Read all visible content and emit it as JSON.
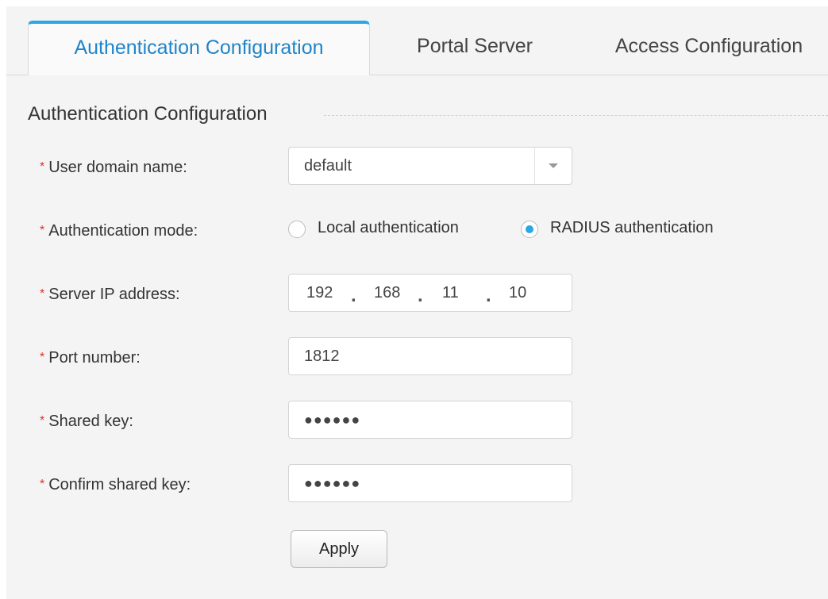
{
  "tabs": [
    {
      "label": "Authentication Configuration",
      "active": true
    },
    {
      "label": "Portal Server",
      "active": false
    },
    {
      "label": "Access Configuration",
      "active": false
    }
  ],
  "section": {
    "title": "Authentication Configuration"
  },
  "required_marker": "*",
  "form": {
    "user_domain": {
      "label": "User domain name:",
      "value": "default"
    },
    "auth_mode": {
      "label": "Authentication mode:",
      "options": [
        {
          "label": "Local authentication",
          "selected": false
        },
        {
          "label": "RADIUS authentication",
          "selected": true
        }
      ]
    },
    "server_ip": {
      "label": "Server IP address:",
      "octets": [
        "192",
        "168",
        "11",
        "10"
      ],
      "separator": "."
    },
    "port": {
      "label": "Port number:",
      "value": "1812"
    },
    "shared_key": {
      "label": "Shared key:",
      "masked": "●●●●●●"
    },
    "confirm_key": {
      "label": "Confirm shared key:",
      "masked": "●●●●●●"
    }
  },
  "apply_button": {
    "label": "Apply"
  },
  "colors": {
    "accent": "#2aa7e6",
    "active_tab_text": "#1f84c9",
    "required": "#e0322f"
  }
}
